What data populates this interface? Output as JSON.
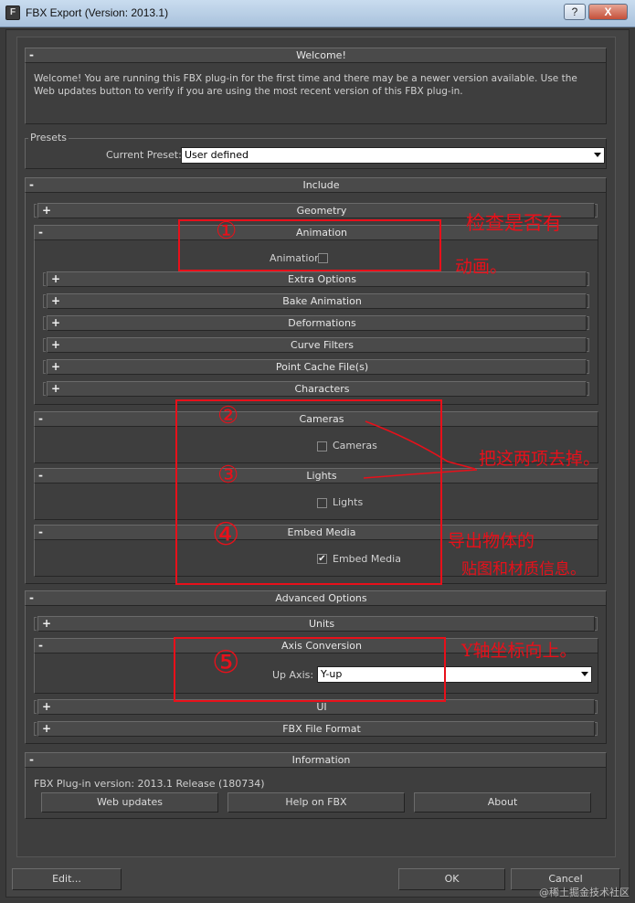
{
  "window": {
    "title": "FBX Export (Version: 2013.1)",
    "help_glyph": "?",
    "close_glyph": "X",
    "icon_glyph": "F"
  },
  "welcome": {
    "header": "Welcome!",
    "text": "Welcome! You are running this FBX plug-in for the first time and there may be a newer version available. Use the Web updates button to verify if you are using the most recent version of this FBX plug-in."
  },
  "presets": {
    "group_label": "Presets",
    "current_label": "Current Preset:",
    "current_value": "User defined"
  },
  "include": {
    "header": "Include",
    "geometry": "Geometry",
    "animation": {
      "header": "Animation",
      "checkbox_label": "Animation",
      "checked": false,
      "subsections": [
        "Extra Options",
        "Bake Animation",
        "Deformations",
        "Curve Filters",
        "Point Cache File(s)",
        "Characters"
      ]
    },
    "cameras": {
      "header": "Cameras",
      "checkbox_label": "Cameras",
      "checked": false
    },
    "lights": {
      "header": "Lights",
      "checkbox_label": "Lights",
      "checked": false
    },
    "embed_media": {
      "header": "Embed Media",
      "checkbox_label": "Embed Media",
      "checked": true
    }
  },
  "advanced": {
    "header": "Advanced Options",
    "units": "Units",
    "axis_conversion": {
      "header": "Axis Conversion",
      "up_axis_label": "Up Axis:",
      "up_axis_value": "Y-up"
    },
    "ui": "UI",
    "fbx_file_format": "FBX File Format"
  },
  "information": {
    "header": "Information",
    "version_text": "FBX Plug-in version: 2013.1 Release (180734)",
    "web_updates": "Web updates",
    "help_on_fbx": "Help on FBX",
    "about": "About"
  },
  "footer": {
    "edit": "Edit...",
    "ok": "OK",
    "cancel": "Cancel"
  },
  "signs": {
    "collapse": "-",
    "expand": "+",
    "check": "✔"
  },
  "annotations": {
    "n1": "①",
    "n2": "②",
    "n3": "③",
    "n4": "④",
    "n5": "⑤",
    "note_animation_1": "检查是否有",
    "note_animation_2": "动画。",
    "note_cameras_lights": "把这两项去掉。",
    "note_embed_1": "导出物体的",
    "note_embed_2": "贴图和材质信息。",
    "note_axis": "Y轴坐标向上。",
    "color": "#e8101a"
  },
  "watermark": "@稀土掘金技术社区"
}
